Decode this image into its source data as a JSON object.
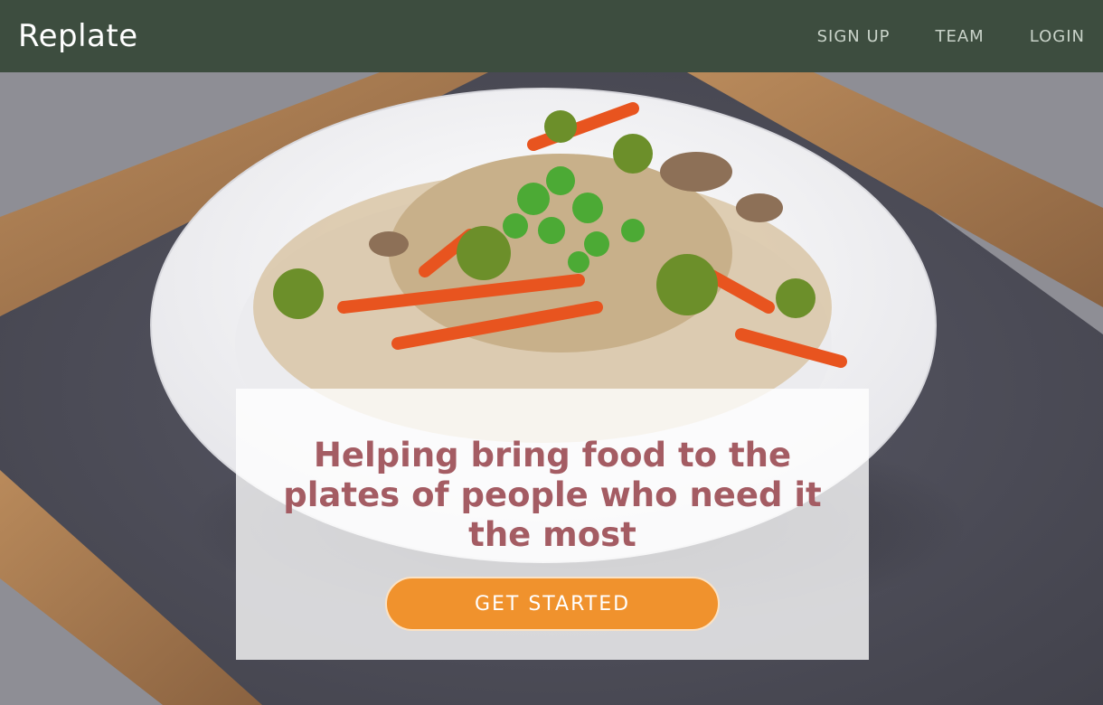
{
  "nav": {
    "brand": "Replate",
    "links": [
      {
        "label": "SIGN UP"
      },
      {
        "label": "TEAM"
      },
      {
        "label": "LOGIN"
      }
    ]
  },
  "hero": {
    "headline": "Helping bring food to the plates of people who need it the most",
    "cta_label": "GET STARTED",
    "image_subject": "bowl of stir-fried vegetables and noodles on a chalkboard tray"
  },
  "colors": {
    "navbar_bg": "#3d4d3f",
    "headline": "#a45c63",
    "cta_bg": "#f0922d"
  }
}
